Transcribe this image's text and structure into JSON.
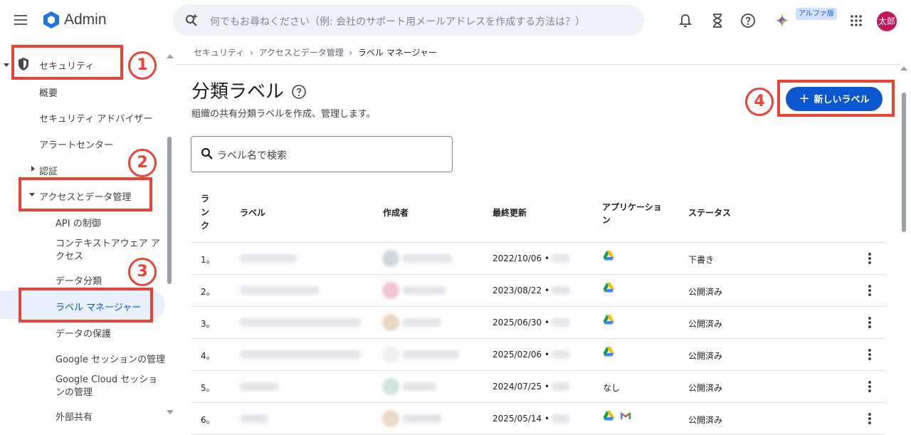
{
  "app": {
    "title": "Admin",
    "avatar_text": "太郎",
    "alpha_badge": "アルファ版"
  },
  "search": {
    "placeholder": "何でもお尋ねください（例: 会社のサポート用メールアドレスを作成する方法は？）"
  },
  "sidebar": {
    "items": [
      {
        "label": "セキュリティ"
      },
      {
        "label": "概要"
      },
      {
        "label": "セキュリティ アドバイザー"
      },
      {
        "label": "アラートセンター"
      },
      {
        "label": "認証"
      },
      {
        "label": "アクセスとデータ管理"
      },
      {
        "label": "API の制御"
      },
      {
        "label": "コンテキストアウェア アクセス"
      },
      {
        "label": "データ分類"
      },
      {
        "label": "ラベル マネージャー"
      },
      {
        "label": "データの保護"
      },
      {
        "label": "Google セッションの管理"
      },
      {
        "label": "Google Cloud セッションの管理"
      },
      {
        "label": "外部共有"
      }
    ]
  },
  "callouts": [
    "1",
    "2",
    "3",
    "4"
  ],
  "breadcrumb": [
    "セキュリティ",
    "アクセスとデータ管理",
    "ラベル マネージャー"
  ],
  "page": {
    "title": "分類ラベル",
    "subtitle": "組織の共有分類ラベルを作成、管理します。",
    "new_button": "新しいラベル",
    "search_placeholder": "ラベル名で検索"
  },
  "table": {
    "headers": {
      "rank": "ランク",
      "label": "ラベル",
      "creator": "作成者",
      "updated": "最終更新",
      "app": "アプリケーション",
      "status": "ステータス"
    },
    "rows": [
      {
        "rank": "1。",
        "updated": "2022/10/06 •",
        "app": [
          "drive"
        ],
        "app_text": "",
        "status": "下書き",
        "avatar_color": "#cfd8dc"
      },
      {
        "rank": "2。",
        "updated": "2023/08/22 •",
        "app": [
          "drive"
        ],
        "app_text": "",
        "status": "公開済み",
        "avatar_color": "#f3c4d3"
      },
      {
        "rank": "3。",
        "updated": "2025/06/30 •",
        "app": [
          "drive"
        ],
        "app_text": "",
        "status": "公開済み",
        "avatar_color": "#ecd5c1"
      },
      {
        "rank": "4。",
        "updated": "2025/02/06 •",
        "app": [
          "drive"
        ],
        "app_text": "",
        "status": "公開済み",
        "avatar_color": "#eef0f2"
      },
      {
        "rank": "5。",
        "updated": "2024/07/25 •",
        "app": [],
        "app_text": "なし",
        "status": "公開済み",
        "avatar_color": "#cfe5dc"
      },
      {
        "rank": "6。",
        "updated": "2025/05/14 •",
        "app": [
          "drive",
          "gmail"
        ],
        "app_text": "",
        "status": "公開済み",
        "avatar_color": "#ecd8c4"
      }
    ]
  }
}
